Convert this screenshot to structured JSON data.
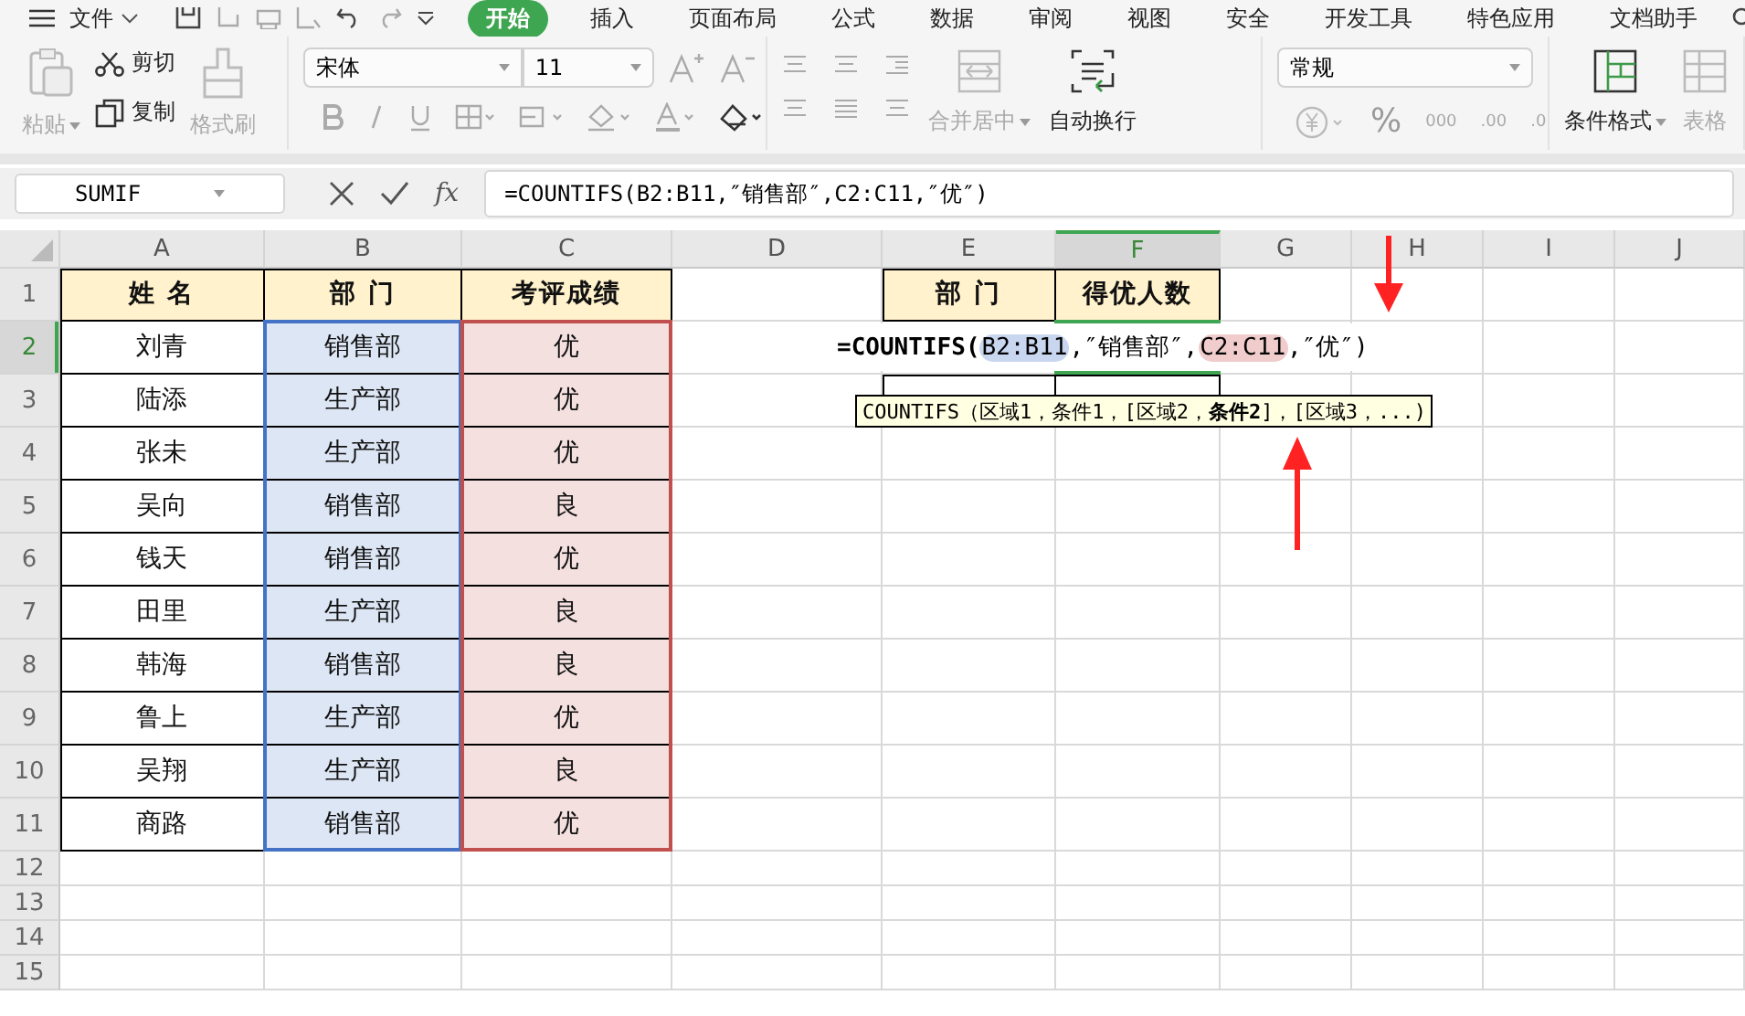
{
  "menu": {
    "file_label": "文件",
    "tabs": [
      {
        "label": "开始",
        "selected": true
      },
      {
        "label": "插入",
        "selected": false
      },
      {
        "label": "页面布局",
        "selected": false
      },
      {
        "label": "公式",
        "selected": false
      },
      {
        "label": "数据",
        "selected": false
      },
      {
        "label": "审阅",
        "selected": false
      },
      {
        "label": "视图",
        "selected": false
      },
      {
        "label": "安全",
        "selected": false
      },
      {
        "label": "开发工具",
        "selected": false
      },
      {
        "label": "特色应用",
        "selected": false
      },
      {
        "label": "文档助手",
        "selected": false
      }
    ]
  },
  "toolbar": {
    "paste": "粘贴",
    "cut": "剪切",
    "copy": "复制",
    "format_painter": "格式刷",
    "font": "宋体",
    "font_size": "11",
    "merge": "合并居中",
    "wrap": "自动换行",
    "number_format": "常规",
    "percent": "%",
    "thousands": "000",
    "increase_decimal": ".00",
    "decrease_decimal": ".0",
    "conditional_format": "条件格式",
    "table_style": "表格"
  },
  "formula_bar": {
    "name_box": "SUMIF",
    "fx": "fx",
    "formula": "=COUNTIFS(B2:B11,″销售部″,C2:C11,″优″)"
  },
  "sheet": {
    "columns": [
      {
        "label": "A",
        "selected": false
      },
      {
        "label": "B",
        "selected": false
      },
      {
        "label": "C",
        "selected": false
      },
      {
        "label": "D",
        "selected": false
      },
      {
        "label": "E",
        "selected": false
      },
      {
        "label": "F",
        "selected": true
      },
      {
        "label": "G",
        "selected": false
      },
      {
        "label": "H",
        "selected": false
      },
      {
        "label": "I",
        "selected": false
      },
      {
        "label": "J",
        "selected": false
      }
    ],
    "rows": [
      {
        "label": "1",
        "selected": false
      },
      {
        "label": "2",
        "selected": true
      },
      {
        "label": "3",
        "selected": false
      },
      {
        "label": "4",
        "selected": false
      },
      {
        "label": "5",
        "selected": false
      },
      {
        "label": "6",
        "selected": false
      },
      {
        "label": "7",
        "selected": false
      },
      {
        "label": "8",
        "selected": false
      },
      {
        "label": "9",
        "selected": false
      },
      {
        "label": "10",
        "selected": false
      },
      {
        "label": "11",
        "selected": false
      },
      {
        "label": "12",
        "selected": false
      },
      {
        "label": "13",
        "selected": false
      },
      {
        "label": "14",
        "selected": false
      },
      {
        "label": "15",
        "selected": false
      }
    ],
    "table": {
      "columns": [
        {
          "header": "姓 名"
        },
        {
          "header": "部 门",
          "color": "#4472c4"
        },
        {
          "header": "考评成绩",
          "color": "#c0504d"
        }
      ],
      "rows": [
        [
          "刘青",
          "销售部",
          "优"
        ],
        [
          "陆添",
          "生产部",
          "优"
        ],
        [
          "张未",
          "生产部",
          "优"
        ],
        [
          "吴向",
          "销售部",
          "良"
        ],
        [
          "钱天",
          "销售部",
          "优"
        ],
        [
          "田里",
          "生产部",
          "良"
        ],
        [
          "韩海",
          "销售部",
          "良"
        ],
        [
          "鲁上",
          "生产部",
          "优"
        ],
        [
          "吴翔",
          "生产部",
          "良"
        ],
        [
          "商路",
          "销售部",
          "优"
        ]
      ]
    },
    "summary": {
      "headers": [
        "部 门",
        "得优人数"
      ]
    },
    "cell_editor": [
      {
        "text": "=COUNTIFS("
      },
      {
        "text": "B2:B11",
        "color": "#c9d6f0"
      },
      {
        "text": ",″销售部″,"
      },
      {
        "text": "C2:C11",
        "color": "#f0cccc"
      },
      {
        "text": ",″优″)"
      }
    ],
    "tooltip": "COUNTIFS（区域1，条件1，[区域2，**条件2**]，[区域3，...)"
  }
}
